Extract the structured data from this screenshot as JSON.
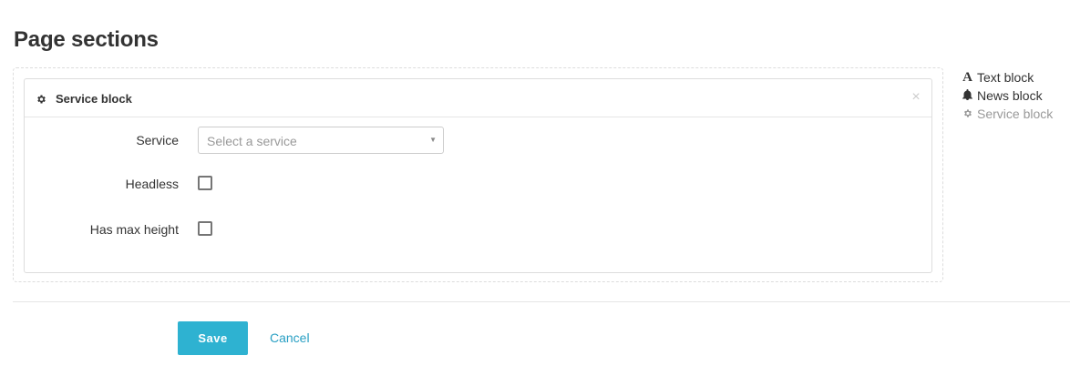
{
  "page": {
    "title": "Page sections"
  },
  "block": {
    "title": "Service block",
    "icon": "gear-icon",
    "close_symbol": "×",
    "fields": {
      "service": {
        "label": "Service",
        "placeholder": "Select a service",
        "arrow": "▼"
      },
      "headless": {
        "label": "Headless",
        "checked": false
      },
      "max_height": {
        "label": "Has max height",
        "checked": false
      }
    }
  },
  "palette": {
    "items": [
      {
        "label": "Text block",
        "icon": "letter-a-icon",
        "icon_glyph": "A"
      },
      {
        "label": "News block",
        "icon": "bell-icon"
      },
      {
        "label": "Service block",
        "icon": "gear-icon"
      }
    ]
  },
  "actions": {
    "save_label": "Save",
    "cancel_label": "Cancel"
  },
  "colors": {
    "primary": "#2eb2d1",
    "link": "#2aa0c4",
    "muted": "#999999",
    "border": "#dddddd"
  }
}
